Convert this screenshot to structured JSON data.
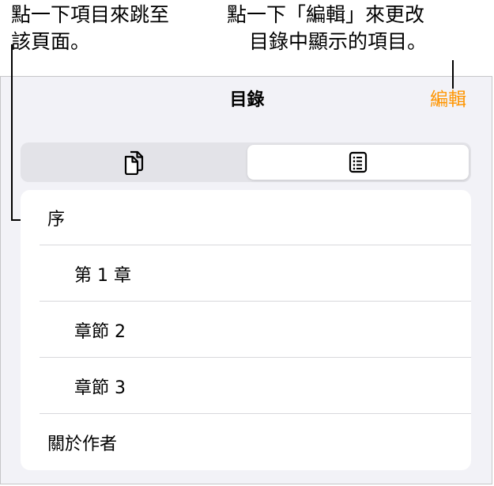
{
  "callouts": {
    "left": {
      "line1": "點一下項目來跳至",
      "line2": "該頁面。"
    },
    "right": {
      "line1": "點一下「編輯」來更改",
      "line2": "目錄中顯示的項目。"
    }
  },
  "header": {
    "title": "目錄",
    "edit_label": "編輯"
  },
  "segmented": {
    "selected": "toc-view",
    "segments": [
      {
        "icon": "page-thumbnails-icon"
      },
      {
        "icon": "table-of-contents-icon"
      }
    ]
  },
  "toc": {
    "items": [
      {
        "label": "序",
        "level": 0
      },
      {
        "label": "第 1 章",
        "level": 1
      },
      {
        "label": "章節 2",
        "level": 1
      },
      {
        "label": "章節 3",
        "level": 1
      },
      {
        "label": "關於作者",
        "level": 0
      }
    ]
  },
  "colors": {
    "accent": "#ff9500",
    "panel_background": "#f2f2f7",
    "divider": "#d8d8dc"
  }
}
